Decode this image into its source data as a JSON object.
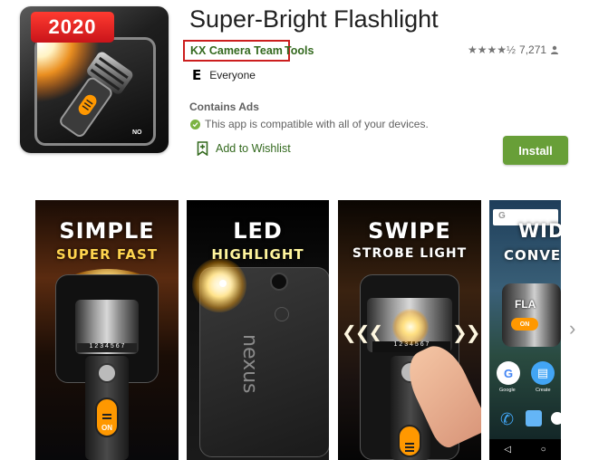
{
  "app": {
    "icon_badge": "2020",
    "icon_label": "NO",
    "title": "Super-Bright Flashlight",
    "developer": "KX Camera Team",
    "category": "Tools",
    "stars": "★★★★½",
    "rating_count": "7,271",
    "content_rating": "Everyone",
    "content_rating_icon": "E",
    "contains_ads": "Contains Ads",
    "compatibility": "This app is compatible with all of your devices.",
    "wishlist_label": "Add to Wishlist",
    "install_label": "Install"
  },
  "screenshots": [
    {
      "line1": "SIMPLE",
      "line2": "SUPER FAST",
      "button_label": "ON"
    },
    {
      "line1": "LED",
      "line2": "HIGHLIGHT",
      "brand": "nexus"
    },
    {
      "line1": "SWIPE",
      "line2": "STROBE LIGHT",
      "arrows": "❮❮❮",
      "arrows_right": "❯❯",
      "dial": "1 2 3 4 5 6 7"
    },
    {
      "line1": "WID",
      "line2": "CONVE",
      "tile_1": "Google",
      "tile_2": "Create",
      "flash_label": "FLA",
      "on_label": "ON"
    }
  ],
  "next_arrow": "›",
  "colors": {
    "install": "#689f38",
    "dev_link": "#33691e",
    "highlight_border": "#cc1e1e"
  }
}
